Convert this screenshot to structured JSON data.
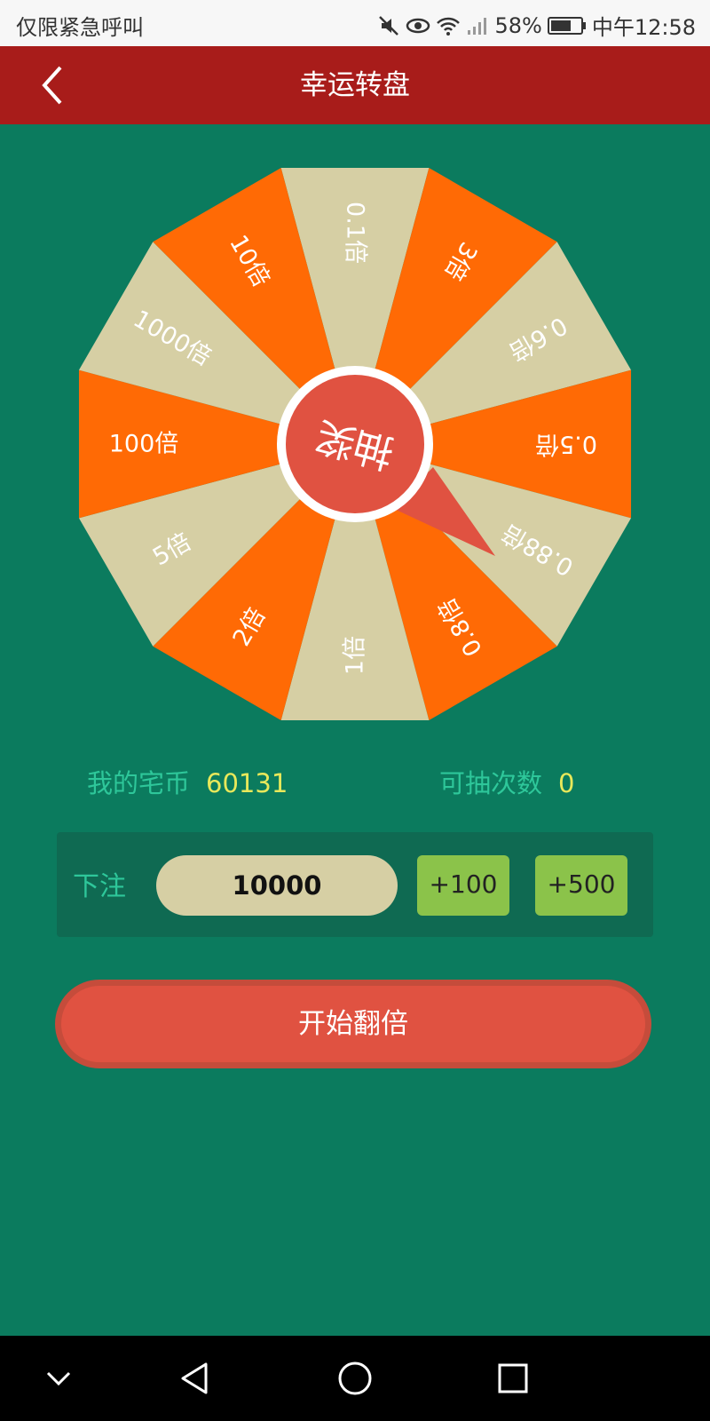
{
  "status_bar": {
    "carrier_text": "仅限紧急呼叫",
    "battery_percent": "58%",
    "time": "中午12:58",
    "icons": [
      "mute-icon",
      "eye-icon",
      "wifi-icon",
      "signal-icon",
      "battery-icon"
    ]
  },
  "header": {
    "title": "幸运转盘",
    "back_icon": "chevron-left-icon",
    "background": "#a81c1a"
  },
  "wheel": {
    "spin_label": "抽奖",
    "segments": [
      {
        "label": "0.1倍"
      },
      {
        "label": "3倍"
      },
      {
        "label": "0.6倍"
      },
      {
        "label": "0.5倍"
      },
      {
        "label": "0.88倍"
      },
      {
        "label": "0.8倍"
      },
      {
        "label": "1倍"
      },
      {
        "label": "2倍"
      },
      {
        "label": "5倍"
      },
      {
        "label": "100倍"
      },
      {
        "label": "1000倍"
      },
      {
        "label": "10倍"
      }
    ],
    "colors": {
      "orange": "#ff6a05",
      "beige": "#d6cfa4",
      "center": "#e05241"
    }
  },
  "stats": {
    "coins_label": "我的宅币",
    "coins_value": "60131",
    "draws_label": "可抽次数",
    "draws_value": "0"
  },
  "bet": {
    "label": "下注",
    "amount": "10000",
    "plus_100": "+100",
    "plus_500": "+500"
  },
  "start_button": {
    "label": "开始翻倍"
  },
  "nav": {
    "icons": [
      "chevron-down-icon",
      "back-triangle-icon",
      "home-circle-icon",
      "recents-square-icon"
    ]
  },
  "colors": {
    "background": "#0b7b5e",
    "accent_green": "#2ec79a",
    "value_yellow": "#e8e85a",
    "button_red": "#e05241"
  }
}
